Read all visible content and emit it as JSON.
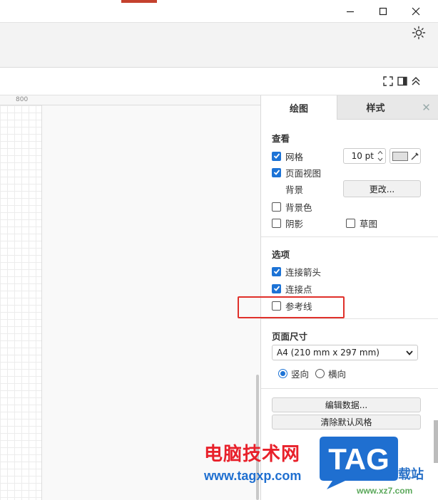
{
  "ruler": {
    "label": "800"
  },
  "panel": {
    "tabs": {
      "draw": "绘图",
      "style": "样式",
      "close": "✕"
    },
    "view": {
      "title": "查看",
      "grid_label": "网格",
      "grid_checked": true,
      "grid_size": "10 pt",
      "page_view_label": "页面视图",
      "page_view_checked": true,
      "background_label": "背景",
      "change_button": "更改...",
      "bg_color_label": "背景色",
      "bg_color_checked": false,
      "shadow_label": "阴影",
      "shadow_checked": false,
      "sketch_label": "草图",
      "sketch_checked": false
    },
    "options": {
      "title": "选项",
      "connect_arrows_label": "连接箭头",
      "connect_arrows_checked": true,
      "connection_points_label": "连接点",
      "connection_points_checked": true,
      "guides_label": "参考线",
      "guides_checked": false
    },
    "page_size": {
      "title": "页面尺寸",
      "selected": "A4 (210 mm x 297 mm)",
      "portrait_label": "竖向",
      "portrait_selected": true,
      "landscape_label": "横向"
    },
    "buttons": {
      "edit_data": "编辑数据...",
      "clear_default_style": "清除默认风格"
    }
  },
  "watermark": {
    "site_name": "电脑技术网",
    "site_url": "www.tagxp.com",
    "logo_text": "TAG",
    "side_text": "载站",
    "side_url": "www.xz7.com"
  },
  "colors": {
    "accent": "#1c73d6",
    "highlight": "#e0302a",
    "watermark_red": "#e8202a",
    "watermark_blue": "#1f6fd0"
  }
}
